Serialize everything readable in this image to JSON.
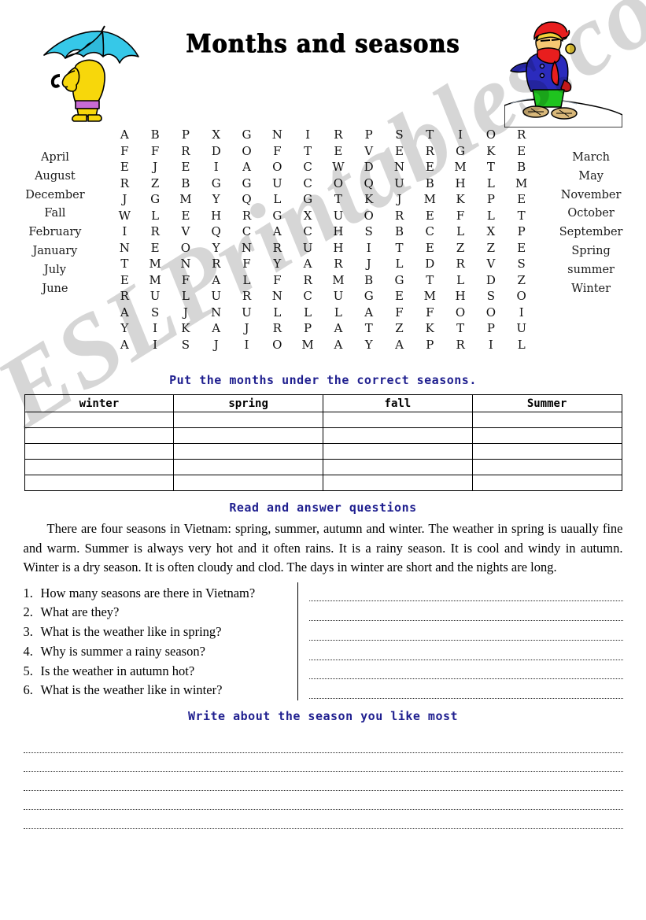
{
  "title": "Months and seasons",
  "clipart": {
    "left_alt": "person-with-umbrella-in-rain",
    "right_alt": "person-in-winter-clothes-on-snow"
  },
  "wordsearch": {
    "words_left": [
      "April",
      "August",
      "December",
      "Fall",
      "February",
      "January",
      "July",
      "June"
    ],
    "words_right": [
      "March",
      "May",
      "November",
      "October",
      "September",
      "Spring",
      "summer",
      "Winter"
    ],
    "rows": 15,
    "cols": 14,
    "grid": [
      [
        "A",
        "B",
        "P",
        "X",
        "G",
        "N",
        "I",
        "R",
        "P",
        "S",
        "T",
        "I",
        "O",
        "R"
      ],
      [
        "F",
        "F",
        "R",
        "D",
        "O",
        "F",
        "T",
        "E",
        "V",
        "E",
        "R",
        "G",
        "K",
        "E"
      ],
      [
        "E",
        "J",
        "E",
        "I",
        "A",
        "O",
        "C",
        "W",
        "D",
        "N",
        "E",
        "M",
        "T",
        "B"
      ],
      [
        "R",
        "Z",
        "B",
        "G",
        "G",
        "U",
        "C",
        "O",
        "Q",
        "U",
        "B",
        "H",
        "L",
        "M"
      ],
      [
        "J",
        "G",
        "M",
        "Y",
        "Q",
        "L",
        "G",
        "T",
        "K",
        "J",
        "M",
        "K",
        "P",
        "E"
      ],
      [
        "W",
        "L",
        "E",
        "H",
        "R",
        "G",
        "X",
        "U",
        "O",
        "R",
        "E",
        "F",
        "L",
        "T"
      ],
      [
        "I",
        "R",
        "V",
        "Q",
        "C",
        "A",
        "C",
        "H",
        "S",
        "B",
        "C",
        "L",
        "X",
        "P"
      ],
      [
        "N",
        "E",
        "O",
        "Y",
        "N",
        "R",
        "U",
        "H",
        "I",
        "T",
        "E",
        "Z",
        "Z",
        "E"
      ],
      [
        "T",
        "M",
        "N",
        "R",
        "F",
        "Y",
        "A",
        "R",
        "J",
        "L",
        "D",
        "R",
        "V",
        "S"
      ],
      [
        "E",
        "M",
        "F",
        "A",
        "L",
        "F",
        "R",
        "M",
        "B",
        "G",
        "T",
        "L",
        "D",
        "Z"
      ],
      [
        "R",
        "U",
        "L",
        "U",
        "R",
        "N",
        "C",
        "U",
        "G",
        "E",
        "M",
        "H",
        "S",
        "O"
      ],
      [
        "A",
        "S",
        "J",
        "N",
        "U",
        "L",
        "L",
        "L",
        "A",
        "F",
        "F",
        "O",
        "O",
        "I"
      ],
      [
        "Y",
        "I",
        "K",
        "A",
        "J",
        "R",
        "P",
        "A",
        "T",
        "Z",
        "K",
        "T",
        "P",
        "U"
      ],
      [
        "A",
        "I",
        "S",
        "J",
        "I",
        "O",
        "M",
        "A",
        "Y",
        "A",
        "P",
        "R",
        "I",
        "L"
      ]
    ]
  },
  "instruction_1": "Put the months under the correct seasons.",
  "seasons_table": {
    "headers": [
      "winter",
      "spring",
      "fall",
      "Summer"
    ],
    "empty_rows": 5
  },
  "instruction_2": "Read and answer questions",
  "passage": "There are four seasons in Vietnam: spring, summer, autumn and winter. The weather in spring is uaually fine and warm. Summer is always very hot and it often rains. It is a rainy season. It is cool and windy in autumn. Winter is a dry season. It is often cloudy and clod. The days in winter are short and the nights are long.",
  "questions": [
    {
      "num": "1.",
      "text": "How many seasons are there in Vietnam?"
    },
    {
      "num": "2.",
      "text": "What are they?"
    },
    {
      "num": "3.",
      "text": "What is the weather like in spring?"
    },
    {
      "num": "4.",
      "text": "Why is summer a rainy season?"
    },
    {
      "num": "5.",
      "text": "Is the weather in autumn hot?"
    },
    {
      "num": "6.",
      "text": "What is the weather like in winter?"
    }
  ],
  "answer_lines": 6,
  "instruction_3": "Write about the season you like most",
  "writing_lines": 5,
  "watermark": "ESLPrintables.com",
  "colors": {
    "instruction_blue": "#1f1f8f",
    "umbrella_cyan": "#36c8e8",
    "raincoat_yellow": "#f7d70b",
    "coat_blue": "#2b2bbd",
    "hat_red": "#e81e1e",
    "pants_green": "#1fc41f"
  }
}
